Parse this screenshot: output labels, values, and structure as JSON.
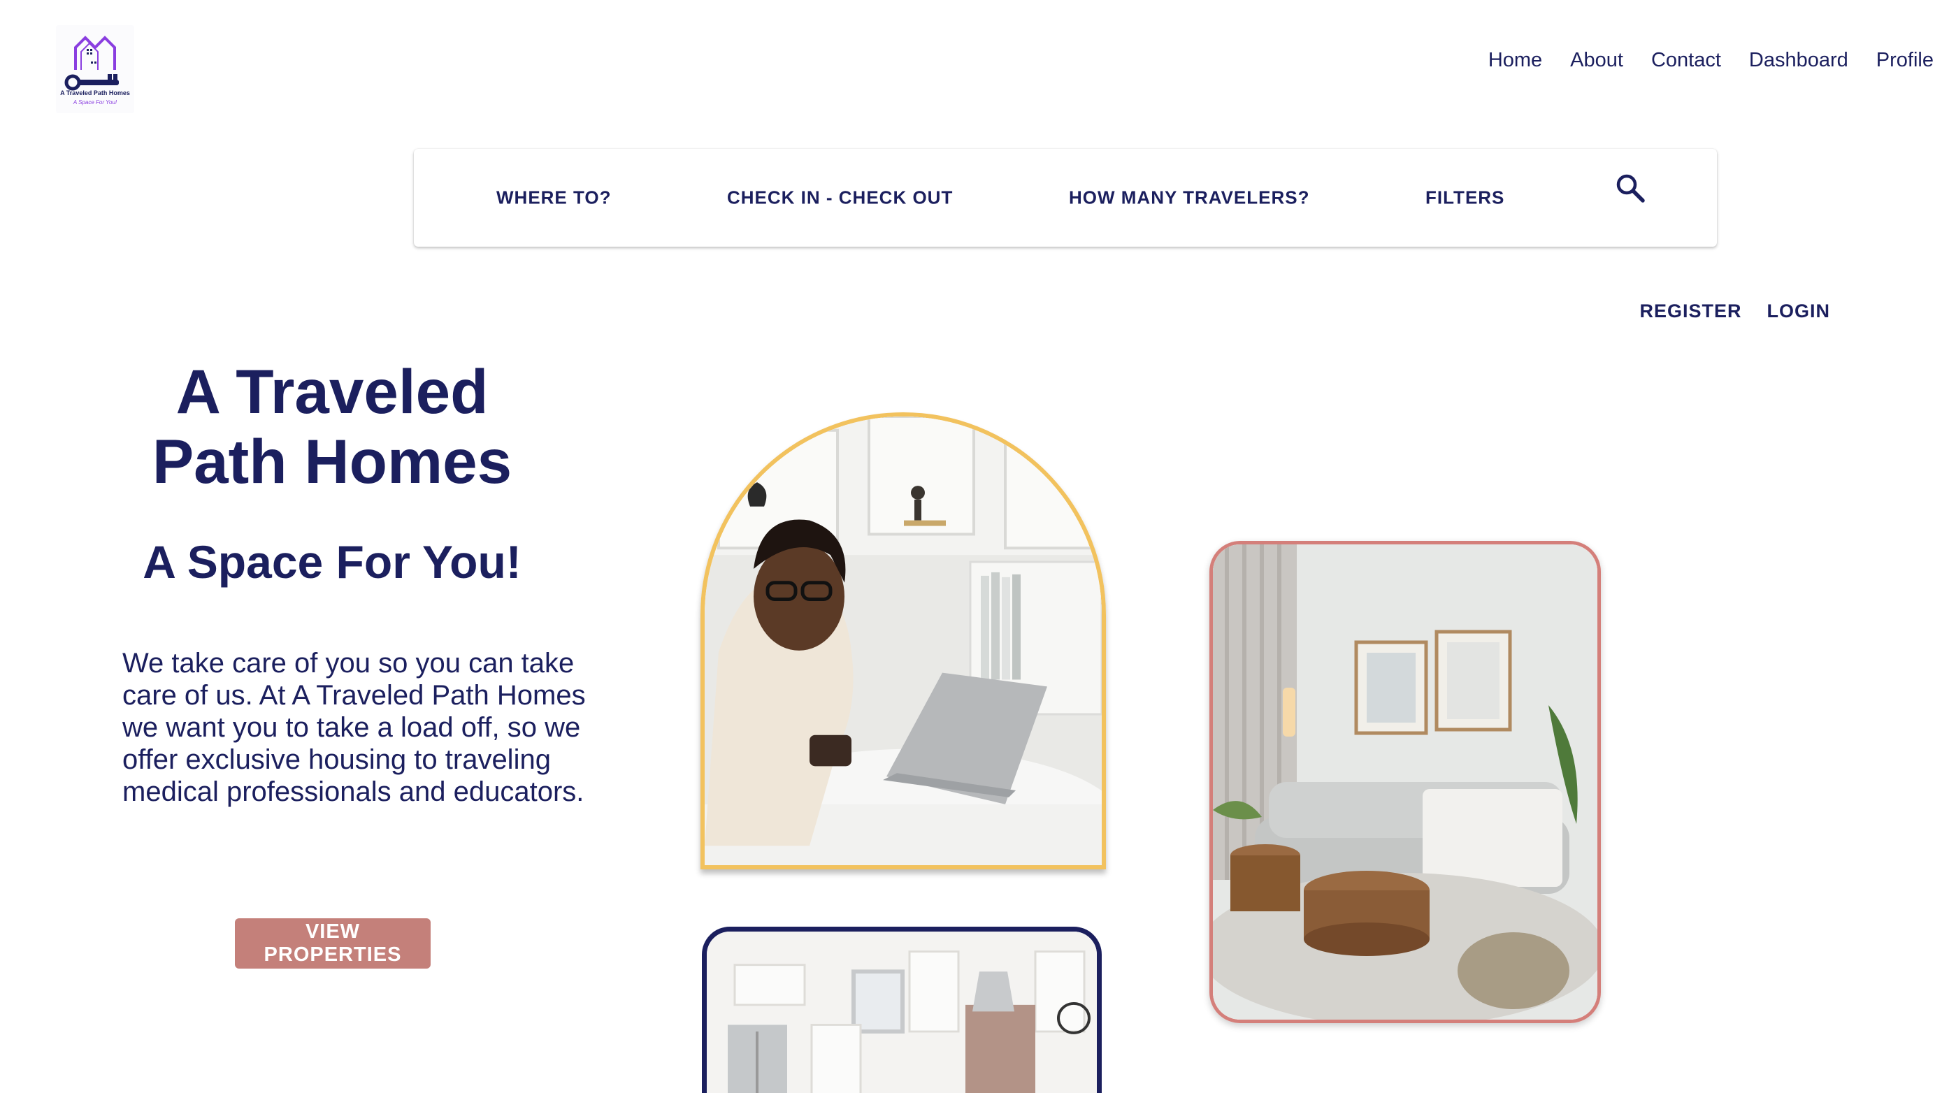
{
  "brand": {
    "logo_title": "A Traveled Path Homes",
    "logo_tagline": "A Space For You!",
    "logo_icon": "house-key-icon",
    "logo_color": "#8a3ee0"
  },
  "nav": {
    "items": [
      "Home",
      "About",
      "Contact",
      "Dashboard",
      "Profile"
    ]
  },
  "search_bar": {
    "where": "WHERE TO?",
    "dates": "CHECK IN - CHECK OUT",
    "travelers": "HOW MANY TRAVELERS?",
    "filters": "FILTERS",
    "search_icon": "search-icon"
  },
  "auth": {
    "register": "REGISTER",
    "login": "LOGIN"
  },
  "hero": {
    "title_line1": "A Traveled",
    "title_line2": "Path Homes",
    "subtitle": "A Space For You!",
    "body": "We take care of you so you can take care of us. At A Traveled Path Homes we want you to take a load off, so we offer exclusive housing to traveling medical professionals and educators.",
    "cta": "VIEW PROPERTIES"
  },
  "colors": {
    "primary_navy": "#1b1f5e",
    "accent_rose": "#c4807a",
    "accent_gold": "#f2c25e",
    "accent_purple": "#8a3ee0"
  }
}
